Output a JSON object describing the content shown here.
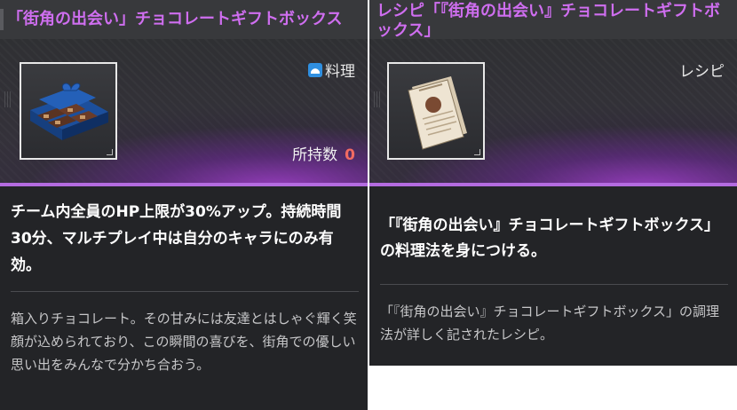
{
  "left_card": {
    "title": "「街角の出会い」チョコレートギフトボックス",
    "category": {
      "icon": "cooking-icon",
      "label": "料理"
    },
    "owned": {
      "label": "所持数",
      "count": "0"
    },
    "effect": "チーム内全員のHP上限が30%アップ。持続時間30分、マルチプレイ中は自分のキャラにのみ有効。",
    "description": "箱入りチョコレート。その甘みには友達とはしゃぐ輝く笑顔が込められており、この瞬間の喜びを、街角での優しい思い出をみんなで分かち合おう。",
    "item_image": "chocolate-gift-box"
  },
  "right_card": {
    "title": "レシピ「『街角の出会い』チョコレートギフトボックス」",
    "category": {
      "label": "レシピ"
    },
    "effect": "「『街角の出会い』チョコレートギフトボックス」の料理法を身につける。",
    "description": "「『街角の出会い』チョコレートギフトボックス」の調理法が詳しく記されたレシピ。",
    "item_image": "recipe-paper"
  },
  "colors": {
    "title_purple": "#cf6ef0",
    "accent_line": "#b46be0",
    "count_red": "#f26b62",
    "panel_bg": "#232427"
  }
}
